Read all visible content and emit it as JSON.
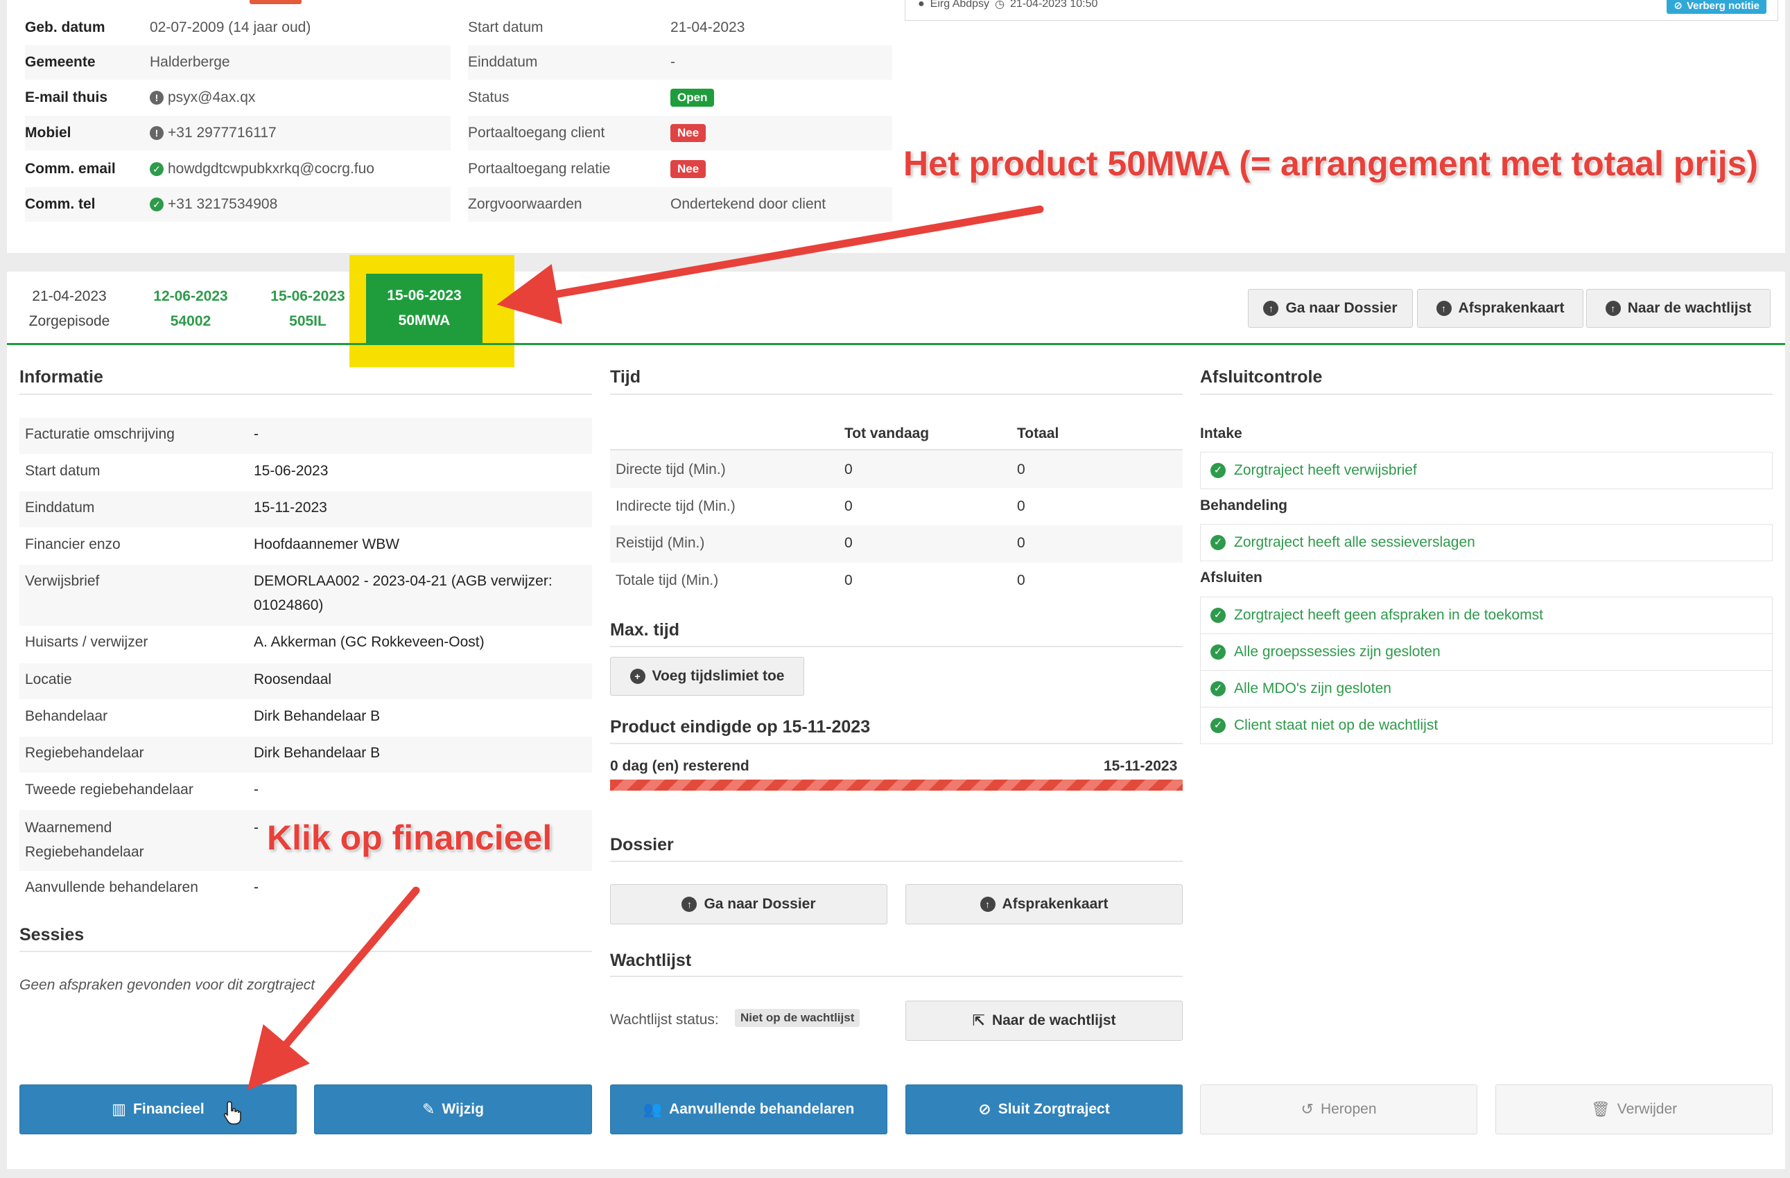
{
  "patient": {
    "left": [
      {
        "label": "Geb. datum",
        "value": "02-07-2009 (14 jaar oud)",
        "icon": null
      },
      {
        "label": "Gemeente",
        "value": "Halderberge",
        "icon": null
      },
      {
        "label": "E-mail thuis",
        "value": "psyx@4ax.qx",
        "icon": "warning"
      },
      {
        "label": "Mobiel",
        "value": "+31 2977716117",
        "icon": "warning"
      },
      {
        "label": "Comm. email",
        "value": "howdgdtcwpubkxrkq@cocrg.fuo",
        "icon": "check"
      },
      {
        "label": "Comm. tel",
        "value": "+31 3217534908",
        "icon": "check"
      }
    ],
    "right": [
      {
        "label": "Start datum",
        "value": "21-04-2023"
      },
      {
        "label": "Einddatum",
        "value": "-"
      },
      {
        "label": "Status",
        "badge": "Open",
        "badge_color": "#1f9d3d"
      },
      {
        "label": "Portaaltoegang client",
        "badge": "Nee",
        "badge_color": "#e04343"
      },
      {
        "label": "Portaaltoegang relatie",
        "badge": "Nee",
        "badge_color": "#e04343"
      },
      {
        "label": "Zorgvoorwaarden",
        "value": "Ondertekend door client"
      }
    ],
    "note": {
      "author": "Eirg Abdpsy",
      "datetime": "21-04-2023 10:50",
      "hide_label": "Verberg notitie"
    }
  },
  "tabs": [
    {
      "line1": "21-04-2023",
      "line2": "Zorgepisode"
    },
    {
      "line1": "12-06-2023",
      "line2": "54002"
    },
    {
      "line1": "15-06-2023",
      "line2": "505IL"
    },
    {
      "line1": "15-06-2023",
      "line2": "50MWA"
    }
  ],
  "top_buttons": {
    "dossier": "Ga naar Dossier",
    "afspraken": "Afsprakenkaart",
    "wachtlijst": "Naar de wachtlijst"
  },
  "informatie": {
    "title": "Informatie",
    "rows": [
      {
        "label": "Facturatie omschrijving",
        "value": "-"
      },
      {
        "label": "Start datum",
        "value": "15-06-2023"
      },
      {
        "label": "Einddatum",
        "value": "15-11-2023"
      },
      {
        "label": "Financier enzo",
        "value": "Hoofdaannemer WBW"
      },
      {
        "label": "Verwijsbrief",
        "value": "DEMORLAA002 - 2023-04-21 (AGB verwijzer:",
        "value2": "01024860)"
      },
      {
        "label": "Huisarts / verwijzer",
        "value": "A. Akkerman (GC Rokkeveen-Oost)"
      },
      {
        "label": "Locatie",
        "value": "Roosendaal"
      },
      {
        "label": "Behandelaar",
        "value": "Dirk Behandelaar B"
      },
      {
        "label": "Regiebehandelaar",
        "value": "Dirk Behandelaar B"
      },
      {
        "label": "Tweede regiebehandelaar",
        "value": "-"
      },
      {
        "label": "Waarnemend",
        "label2": "Regiebehandelaar",
        "value": "-"
      },
      {
        "label": "Aanvullende behandelaren",
        "value": "-"
      }
    ]
  },
  "sessies": {
    "title": "Sessies",
    "empty": "Geen afspraken gevonden voor dit zorgtraject"
  },
  "tijd": {
    "title": "Tijd",
    "col_today": "Tot vandaag",
    "col_total": "Totaal",
    "rows": [
      {
        "label": "Directe tijd (Min.)",
        "today": "0",
        "total": "0"
      },
      {
        "label": "Indirecte tijd (Min.)",
        "today": "0",
        "total": "0"
      },
      {
        "label": "Reistijd (Min.)",
        "today": "0",
        "total": "0"
      },
      {
        "label": "Totale tijd (Min.)",
        "today": "0",
        "total": "0"
      }
    ]
  },
  "max_tijd": {
    "title": "Max. tijd",
    "button": "Voeg tijdslimiet toe"
  },
  "product": {
    "title": "Product eindigde op 15-11-2023",
    "remaining": "0 dag (en) resterend",
    "end_date": "15-11-2023",
    "progress_pct": 100
  },
  "dossier": {
    "title": "Dossier",
    "btn_dossier": "Ga naar Dossier",
    "btn_afspraken": "Afsprakenkaart"
  },
  "wachtlijst": {
    "title": "Wachtlijst",
    "status_label": "Wachtlijst status:",
    "status_badge": "Niet op de wachtlijst",
    "button": "Naar de wachtlijst"
  },
  "afsluit": {
    "title": "Afsluitcontrole",
    "groups": [
      {
        "name": "Intake",
        "items": [
          "Zorgtraject heeft verwijsbrief"
        ]
      },
      {
        "name": "Behandeling",
        "items": [
          "Zorgtraject heeft alle sessieverslagen"
        ]
      },
      {
        "name": "Afsluiten",
        "items": [
          "Zorgtraject heeft geen afspraken in de toekomst",
          "Alle groepssessies zijn gesloten",
          "Alle MDO's zijn gesloten",
          "Client staat niet op de wachtlijst"
        ]
      }
    ]
  },
  "bottom_buttons": {
    "financieel": "Financieel",
    "wijzig": "Wijzig",
    "aanvullend": "Aanvullende behandelaren",
    "sluit": "Sluit Zorgtraject",
    "heropen": "Heropen",
    "verwijder": "Verwijder"
  },
  "annotations": {
    "product": "Het product 50MWA  (= arrangement met totaal prijs)",
    "klik": "Klik op financieel"
  },
  "colors": {
    "accent_green": "#1f9d3d",
    "brand_blue": "#3183bb",
    "danger": "#e04343",
    "annotation_red": "#e8413a",
    "highlight_yellow": "#f7e000"
  }
}
